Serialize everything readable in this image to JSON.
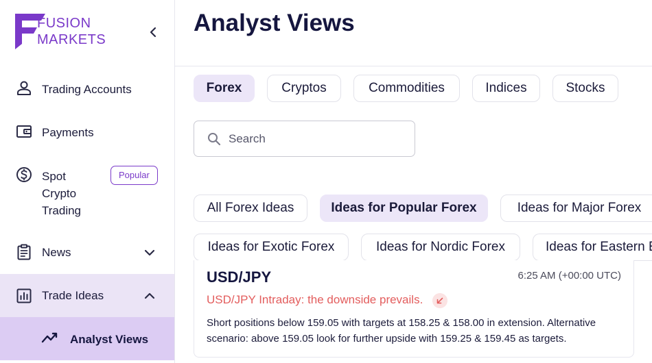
{
  "brand": {
    "line1": "FUSION",
    "line2": "MARKETS",
    "color": "#7a39c9"
  },
  "sidebar": {
    "items": [
      {
        "label": "Trading Accounts",
        "icon": "user-icon"
      },
      {
        "label": "Payments",
        "icon": "wallet-icon"
      },
      {
        "label_lines": [
          "Spot",
          "Crypto",
          "Trading"
        ],
        "icon": "dollar-circle-icon",
        "badge": "Popular"
      },
      {
        "label": "News",
        "icon": "clipboard-icon",
        "chevron": "chevron-down-icon"
      },
      {
        "label": "Trade Ideas",
        "icon": "chart-bar-icon",
        "chevron": "chevron-up-icon"
      },
      {
        "label": "Analyst Views",
        "icon": "trend-line-icon"
      }
    ]
  },
  "main": {
    "title": "Analyst Views",
    "category_tabs": [
      "Forex",
      "Cryptos",
      "Commodities",
      "Indices",
      "Stocks"
    ],
    "active_category": "Forex",
    "search": {
      "placeholder": "Search",
      "value": ""
    },
    "idea_filters_row1": [
      "All Forex Ideas",
      "Ideas for Popular Forex",
      "Ideas for Major Forex"
    ],
    "idea_filters_row2": [
      "Ideas for Exotic Forex",
      "Ideas for Nordic Forex",
      "Ideas for Eastern Europe Forex"
    ],
    "active_filter": "Ideas for Popular Forex",
    "card": {
      "symbol": "USD/JPY",
      "time": "6:25 AM (+00:00 UTC)",
      "headline": "USD/JPY Intraday: the downside prevails.",
      "headline_color": "#e35d5d",
      "direction_icon": "arrow-down-left-icon",
      "body": "Short positions below 159.05 with targets at 158.25 & 158.00 in extension. Alternative scenario: above 159.05 look for further upside with 159.25 & 159.45 as targets."
    }
  }
}
